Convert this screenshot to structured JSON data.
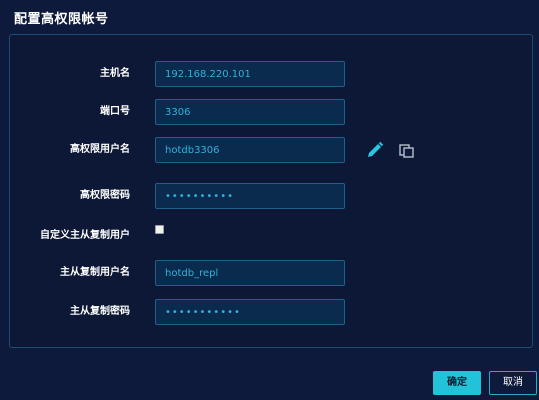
{
  "dialog": {
    "title": "配置高权限帐号"
  },
  "form": {
    "hostname": {
      "label": "主机名",
      "value": "192.168.220.101"
    },
    "port": {
      "label": "端口号",
      "value": "3306"
    },
    "admin_user": {
      "label": "高权限用户名",
      "value": "hotdb3306"
    },
    "admin_password": {
      "label": "高权限密码",
      "value": "••••••••••"
    },
    "custom_repl_user": {
      "label": "自定义主从复制用户",
      "checked": false
    },
    "repl_user": {
      "label": "主从复制用户名",
      "value": "hotdb_repl"
    },
    "repl_password": {
      "label": "主从复制密码",
      "value": "•••••••••••"
    }
  },
  "icons": {
    "edit": "pencil-icon",
    "copy": "copy-icon"
  },
  "buttons": {
    "ok": "确定",
    "cancel": "取消"
  },
  "colors": {
    "background": "#0e1a3c",
    "input_bg": "#0a2a4e",
    "input_border": "#1f5f8a",
    "input_text": "#2fb3d9",
    "accent": "#22c3d8"
  }
}
